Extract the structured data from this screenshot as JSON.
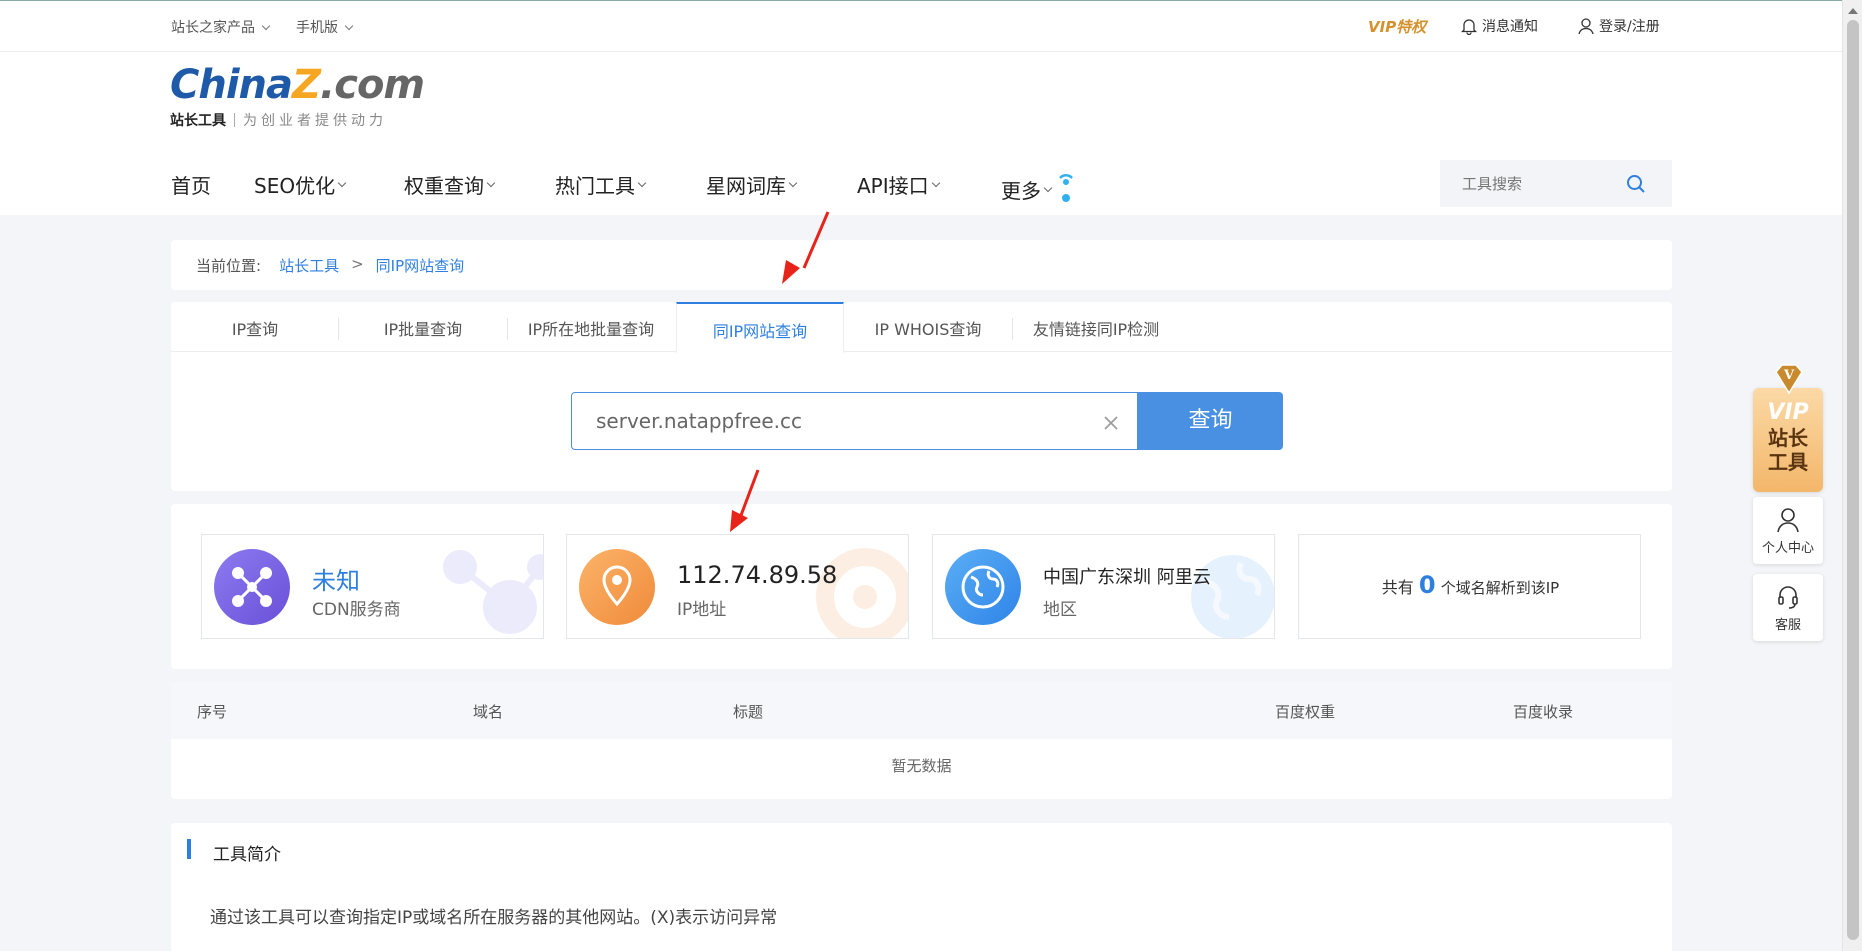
{
  "topbar": {
    "products_label": "站长之家产品",
    "mobile_label": "手机版",
    "vip_label": "VIP特权",
    "notify_label": "消息通知",
    "login_label": "登录/注册"
  },
  "logo": {
    "brand": "ChinaZ.com",
    "brand_part1": "China",
    "brand_part2": "Z",
    "brand_part3": ".com",
    "sub_left": "站长工具",
    "sub_right": "为创业者提供动力"
  },
  "nav": {
    "items": [
      {
        "label": "首页"
      },
      {
        "label": "SEO优化"
      },
      {
        "label": "权重查询"
      },
      {
        "label": "热门工具"
      },
      {
        "label": "星网词库"
      },
      {
        "label": "API接口"
      },
      {
        "label": "更多"
      }
    ],
    "search_placeholder": "工具搜索"
  },
  "breadcrumb": {
    "prefix": "当前位置:",
    "root": "站长工具",
    "separator": ">",
    "current": "同IP网站查询"
  },
  "tabs": [
    {
      "label": "IP查询",
      "active": false
    },
    {
      "label": "IP批量查询",
      "active": false
    },
    {
      "label": "IP所在地批量查询",
      "active": false
    },
    {
      "label": "同IP网站查询",
      "active": true
    },
    {
      "label": "IP WHOIS查询",
      "active": false
    },
    {
      "label": "友情链接同IP检测",
      "active": false
    }
  ],
  "query": {
    "value": "server.natappfree.cc",
    "button_label": "查询"
  },
  "cards": {
    "cdn": {
      "value": "未知",
      "label": "CDN服务商"
    },
    "ip": {
      "value": "112.74.89.58",
      "label": "IP地址"
    },
    "region": {
      "value": "中国广东深圳 阿里云",
      "label": "地区"
    },
    "count": {
      "prefix": "共有",
      "value": "0",
      "suffix": "个域名解析到该IP"
    }
  },
  "table": {
    "headers": [
      "序号",
      "域名",
      "标题",
      "百度权重",
      "百度收录"
    ],
    "empty_text": "暂无数据"
  },
  "intro": {
    "title": "工具简介",
    "text": "通过该工具可以查询指定IP或域名所在服务器的其他网站。(X)表示访问异常"
  },
  "sidebar": {
    "vip_line1": "VIP",
    "vip_line2": "站长",
    "vip_line3": "工具",
    "vip_badge": "V",
    "personal_label": "个人中心",
    "service_label": "客服"
  },
  "colors": {
    "accent": "#4a90e2",
    "vip_gold": "#d4912e",
    "arrow_red": "#e8231a"
  }
}
